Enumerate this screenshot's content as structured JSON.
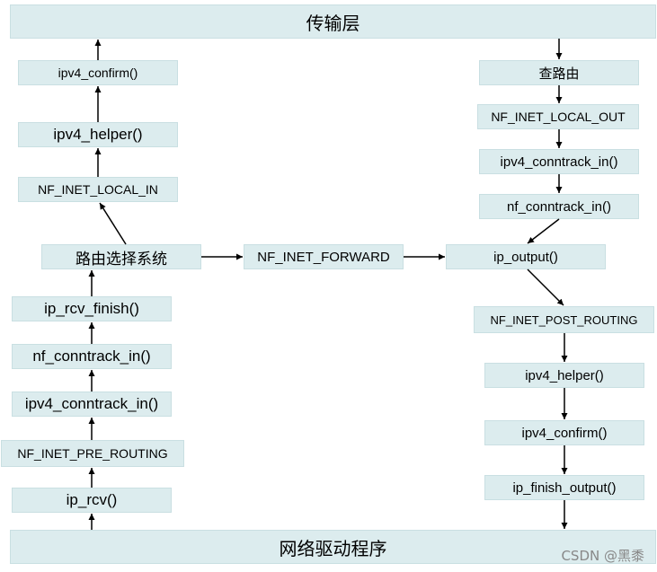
{
  "transport_layer": "传输层",
  "driver_layer": "网络驱动程序",
  "routing_system": "路由选择系统",
  "forward_hook": "NF_INET_FORWARD",
  "ip_output": "ip_output()",
  "input_path": {
    "ip_rcv": "ip_rcv()",
    "pre_routing": "NF_INET_PRE_ROUTING",
    "ipv4_conntrack_in": "ipv4_conntrack_in()",
    "nf_conntrack_in": "nf_conntrack_in()",
    "ip_rcv_finish": "ip_rcv_finish()",
    "local_in": "NF_INET_LOCAL_IN",
    "ipv4_helper": "ipv4_helper()",
    "ipv4_confirm": "ipv4_confirm()"
  },
  "output_path": {
    "route_lookup": "查路由",
    "local_out": "NF_INET_LOCAL_OUT",
    "ipv4_conntrack_in": "ipv4_conntrack_in()",
    "nf_conntrack_in": "nf_conntrack_in()",
    "post_routing": "NF_INET_POST_ROUTING",
    "ipv4_helper": "ipv4_helper()",
    "ipv4_confirm": "ipv4_confirm()",
    "ip_finish_output": "ip_finish_output()"
  },
  "watermark": "CSDN @黑黍"
}
